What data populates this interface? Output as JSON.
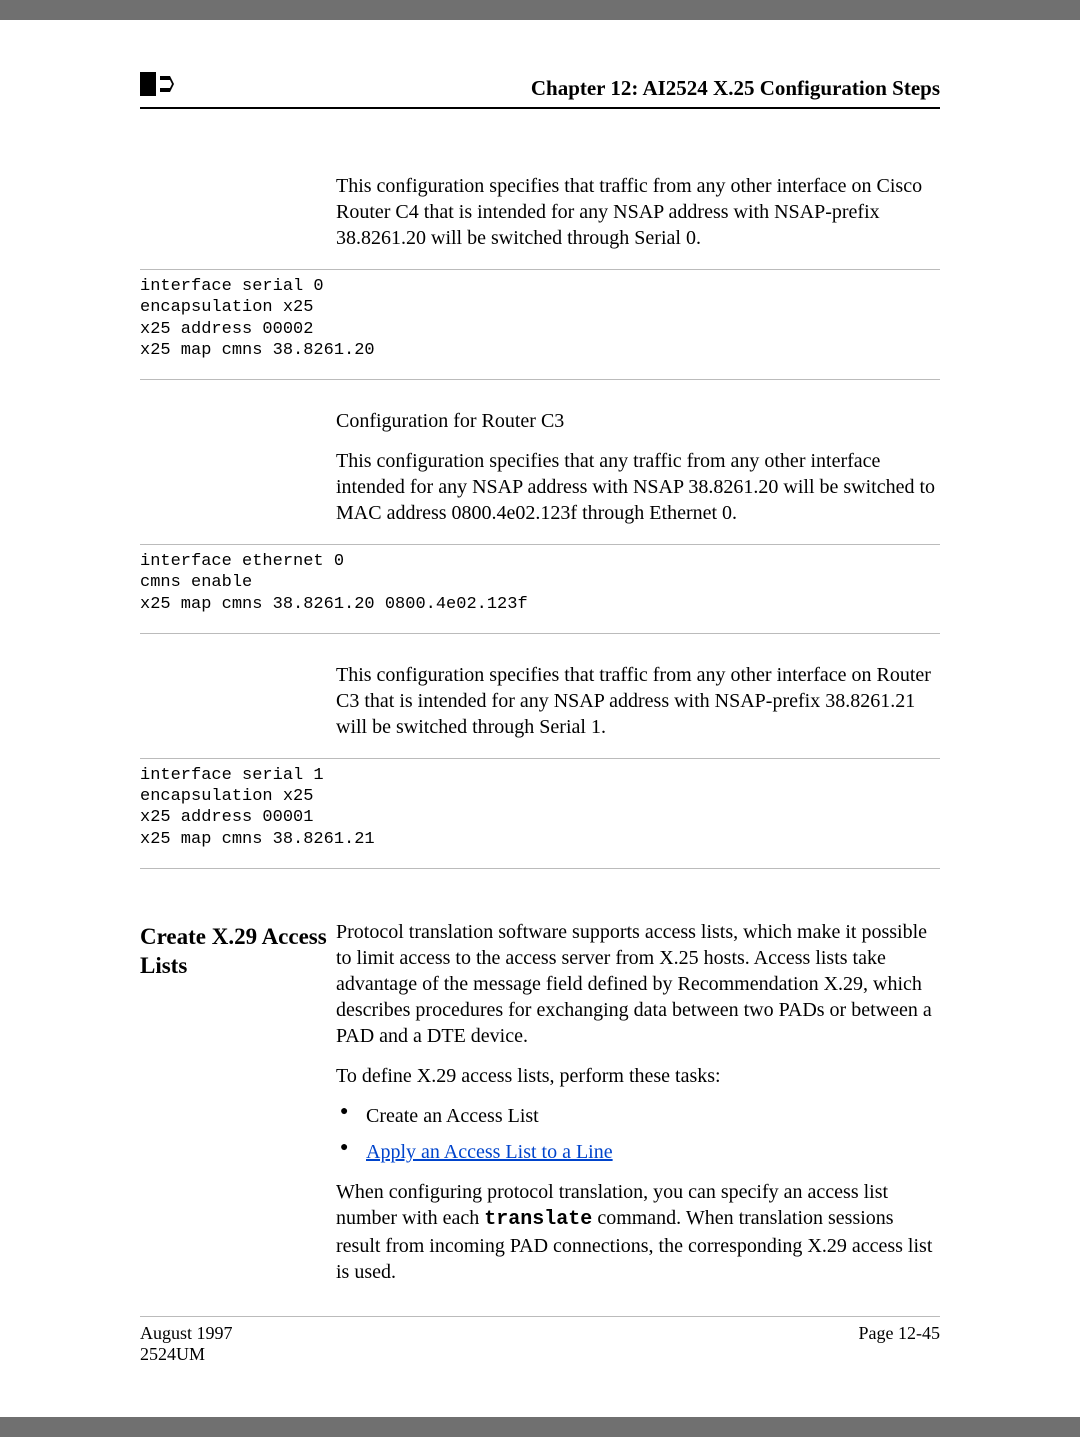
{
  "header": {
    "chapter_title": "Chapter 12: AI2524 X.25 Configuration Steps"
  },
  "block1": {
    "para1": "This configuration specifies that traffic from any other interface on Cisco Router C4 that is intended for any NSAP address with NSAP-prefix 38.8261.20 will be switched through Serial 0.",
    "code": "interface serial 0\nencapsulation x25\nx25 address 00002\nx25 map cmns 38.8261.20"
  },
  "block2": {
    "para1": "Configuration for Router C3",
    "para2": "This configuration specifies that any traffic from any other interface intended for any NSAP address with NSAP 38.8261.20 will be switched to MAC address 0800.4e02.123f through Ethernet 0.",
    "code": "interface ethernet 0\ncmns enable\nx25 map cmns 38.8261.20 0800.4e02.123f"
  },
  "block3": {
    "para1": "This configuration specifies that traffic from any other interface on Router C3 that is intended for any NSAP address with NSAP-prefix 38.8261.21 will be switched through Serial 1.",
    "code": "interface serial 1\nencapsulation x25\nx25 address 00001\nx25 map cmns 38.8261.21"
  },
  "section": {
    "heading": "Create X.29 Access Lists",
    "para1": "Protocol translation software supports access lists, which make it possible to limit access to the access server from X.25 hosts. Access lists take advantage of the message field defined by Recommendation X.29, which describes procedures for exchanging data between two PADs or between a PAD and a DTE device.",
    "para2": "To define X.29 access lists, perform these tasks:",
    "bullets": [
      {
        "type": "plain",
        "text": "Create an Access List"
      },
      {
        "type": "link",
        "text": "Apply an Access List to a Line"
      }
    ],
    "para3_pre": "When configuring protocol translation, you can specify an access list number with each ",
    "translate_cmd": "translate",
    "para3_post": " command. When translation sessions result from incoming PAD connections, the corresponding X.29 access list is used."
  },
  "footer": {
    "left_line1": "August 1997",
    "left_line2": "2524UM",
    "right": "Page 12-45"
  }
}
